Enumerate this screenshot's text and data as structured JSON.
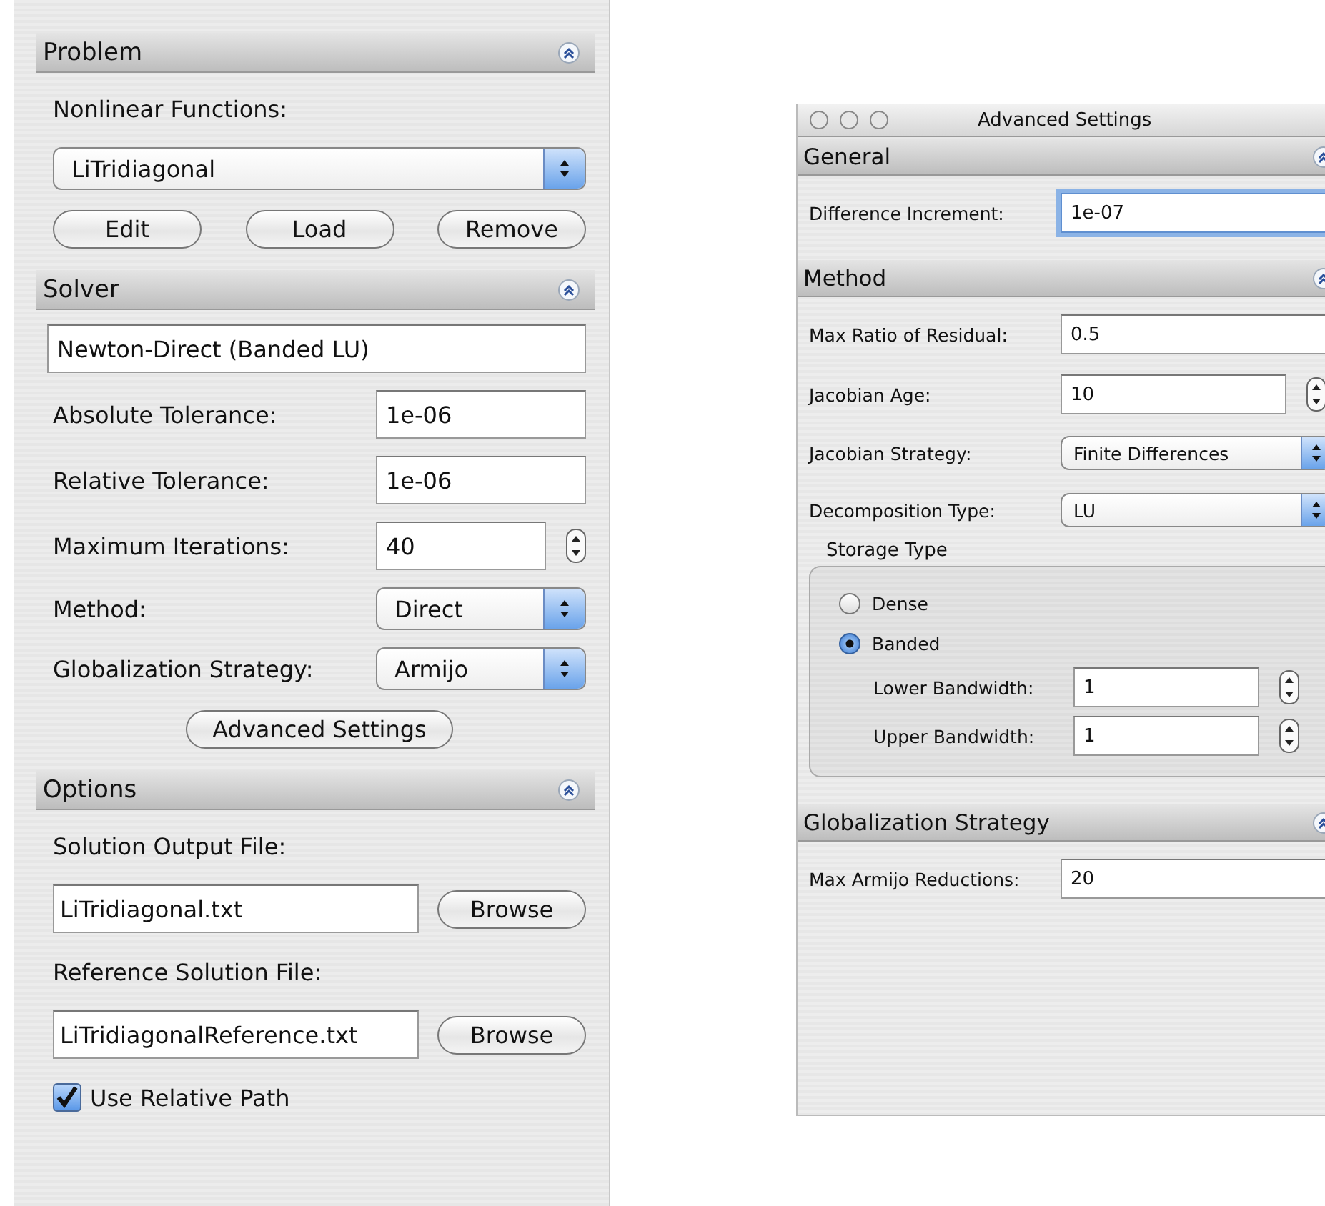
{
  "main_panel": {
    "sections": [
      {
        "title": "Problem",
        "rows": [
          {
            "kind": "label",
            "text": "Nonlinear Functions:"
          },
          {
            "kind": "select",
            "value": "LiTridiagonal"
          },
          {
            "kind": "buttons",
            "buttons": [
              "Edit",
              "Load",
              "Remove"
            ]
          }
        ]
      },
      {
        "title": "Solver",
        "rows": [
          {
            "kind": "text",
            "value": "Newton-Direct (Banded LU)"
          },
          {
            "kind": "field",
            "label": "Absolute Tolerance:",
            "value": "1e-06"
          },
          {
            "kind": "field",
            "label": "Relative Tolerance:",
            "value": "1e-06"
          },
          {
            "kind": "stepper",
            "label": "Maximum Iterations:",
            "value": "40"
          },
          {
            "kind": "select",
            "label": "Method:",
            "value": "Direct"
          },
          {
            "kind": "select",
            "label": "Globalization Strategy:",
            "value": "Armijo"
          },
          {
            "kind": "button",
            "text": "Advanced Settings"
          }
        ]
      },
      {
        "title": "Options",
        "rows": [
          {
            "kind": "label",
            "text": "Solution Output File:"
          },
          {
            "kind": "file",
            "value": "LiTridiagonal.txt",
            "button": "Browse"
          },
          {
            "kind": "label",
            "text": "Reference Solution File:"
          },
          {
            "kind": "file",
            "value": "LiTridiagonalReference.txt",
            "button": "Browse"
          },
          {
            "kind": "checkbox",
            "label": "Use Relative Path",
            "checked": true
          }
        ]
      }
    ]
  },
  "advanced_window": {
    "title": "Advanced Settings",
    "sections": [
      {
        "title": "General",
        "rows": [
          {
            "kind": "field",
            "label": "Difference Increment:",
            "value": "1e-07",
            "focused": true
          }
        ]
      },
      {
        "title": "Method",
        "rows": [
          {
            "kind": "field",
            "label": "Max Ratio of Residual:",
            "value": "0.5",
            "focused": false
          },
          {
            "kind": "stepper",
            "label": "Jacobian Age:",
            "value": "10"
          },
          {
            "kind": "select",
            "label": "Jacobian Strategy:",
            "value": "Finite Differences"
          },
          {
            "kind": "select",
            "label": "Decomposition Type:",
            "value": "LU"
          },
          {
            "kind": "group",
            "title": "Storage Type",
            "rows": [
              {
                "kind": "radio",
                "label": "Dense",
                "selected": false
              },
              {
                "kind": "radio",
                "label": "Banded",
                "selected": true
              },
              {
                "kind": "stepper",
                "label": "Lower Bandwidth:",
                "value": "1"
              },
              {
                "kind": "stepper",
                "label": "Upper Bandwidth:",
                "value": "1"
              }
            ]
          }
        ]
      },
      {
        "title": "Globalization Strategy",
        "rows": [
          {
            "kind": "field",
            "label": "Max Armijo Reductions:",
            "value": "20",
            "focused": false
          }
        ]
      }
    ]
  }
}
